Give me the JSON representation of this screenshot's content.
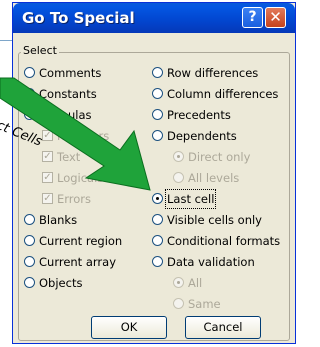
{
  "dialog": {
    "title": "Go To Special",
    "help_glyph": "?",
    "close_glyph": "✕",
    "group_label": "Select",
    "options": {
      "comments": "Comments",
      "constants": "Constants",
      "formulas": "Formulas",
      "numbers": "Numbers",
      "text": "Text",
      "logicals": "Logicals",
      "errors": "Errors",
      "blanks": "Blanks",
      "current_region": "Current region",
      "current_array": "Current array",
      "objects": "Objects",
      "row_differences": "Row differences",
      "column_differences": "Column differences",
      "precedents": "Precedents",
      "dependents": "Dependents",
      "direct_only": "Direct only",
      "all_levels": "All levels",
      "last_cell": "Last cell",
      "visible_cells_only": "Visible cells only",
      "conditional_formats": "Conditional formats",
      "data_validation": "Data validation",
      "all": "All",
      "same": "Same"
    },
    "selected_option": "Last cell",
    "ok_label": "OK",
    "cancel_label": "Cancel"
  },
  "callout": {
    "text": "ct Cells",
    "arrow_color": "#1fa33a"
  }
}
